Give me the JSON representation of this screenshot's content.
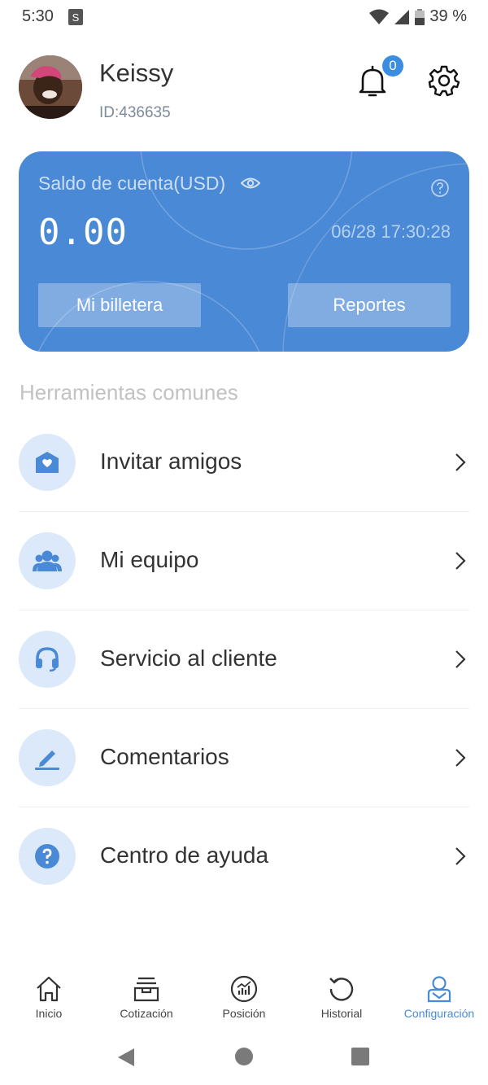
{
  "status_bar": {
    "time": "5:30",
    "battery": "39 %",
    "bag_glyph": "S"
  },
  "profile": {
    "name": "Keissy",
    "id": "ID:436635",
    "notification_count": "0"
  },
  "balance_card": {
    "title": "Saldo de cuenta(USD)",
    "amount": "0.00",
    "timestamp": "06/28 17:30:28",
    "wallet_button": "Mi billetera",
    "reports_button": "Reportes"
  },
  "section": {
    "title": "Herramientas comunes"
  },
  "menu": {
    "items": [
      {
        "label": "Invitar amigos",
        "icon": "invite-envelope-icon"
      },
      {
        "label": "Mi equipo",
        "icon": "team-icon"
      },
      {
        "label": "Servicio al cliente",
        "icon": "headset-icon"
      },
      {
        "label": "Comentarios",
        "icon": "pen-icon"
      },
      {
        "label": "Centro de ayuda",
        "icon": "help-circle-icon"
      }
    ]
  },
  "tabbar": {
    "items": [
      {
        "label": "Inicio",
        "icon": "home-icon",
        "active": false
      },
      {
        "label": "Cotización",
        "icon": "inbox-icon",
        "active": false
      },
      {
        "label": "Posición",
        "icon": "chart-circle-icon",
        "active": false
      },
      {
        "label": "Historial",
        "icon": "history-icon",
        "active": false
      },
      {
        "label": "Configuración",
        "icon": "user-settings-icon",
        "active": true
      }
    ]
  },
  "colors": {
    "accent": "#4a89d6",
    "icon_bg": "#dbe9fa",
    "badge": "#3a8de0"
  }
}
